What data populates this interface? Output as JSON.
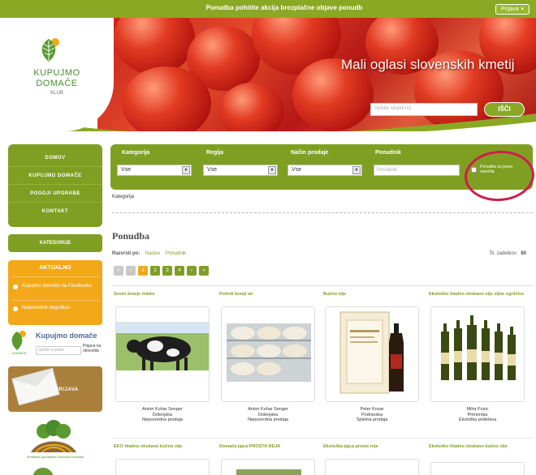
{
  "topbar": {
    "promo_text": "Ponudba pohitite akcija brezplačne objave ponudb",
    "lang_button": "Prijava"
  },
  "header": {
    "logo_line1": "KUPUJMO",
    "logo_line2": "DOMAČE",
    "logo_line3": "KLUB",
    "tagline": "Mali oglasi slovenskih kmetij",
    "search_placeholder": "Vpišite iskalni niz",
    "search_button": "IŠČI"
  },
  "sidebar": {
    "nav_items": [
      "DOMOV",
      "KUPUJMO DOMAČE",
      "POGOJI UPORABE",
      "KONTAKT"
    ],
    "green_button": "KATEGORIJE",
    "orange_box": {
      "title": "AKTUALNO",
      "items": [
        "Kupujmo domače na Facebooku",
        "Napovednik dogodkov"
      ]
    },
    "rapid": {
      "title": "Kupujmo domače",
      "field_placeholder": "vpišite e-pošto",
      "note": "Prijava na obvestila"
    },
    "brown_box_label": "PRIJAVA",
    "sponsor_text": "Kmetijsko gozdarska zbornica Slovenije"
  },
  "filters": {
    "labels": [
      "Kategorija",
      "Regija",
      "Način prodaje",
      "Ponudnik"
    ],
    "selects": [
      "Vse",
      "Vse",
      "Vse"
    ],
    "ponudnik_placeholder": "Ponudnik",
    "checkbox_label": "Ponudba za javna naročila"
  },
  "main": {
    "kategorija_link": "Kategorija",
    "section_title": "Ponudba",
    "sort_label": "Razvrsti po:",
    "sort_links": [
      "Naslov",
      "Ponudnik"
    ],
    "count_label": "Št. zadetkov:",
    "count_value": "80",
    "pages": [
      "«",
      "‹",
      "1",
      "2",
      "3",
      "4",
      "›",
      "»"
    ]
  },
  "cards_row1": [
    {
      "title": "Sveže kravje mleko",
      "desc": [
        "Anton Kuhar Senger",
        "Dolenjska",
        "Neposredna prodaja"
      ]
    },
    {
      "title": "Poltrdi kravji sir",
      "desc": [
        "Anton Kuhar Senger",
        "Dolenjska",
        "Neposredna prodaja"
      ]
    },
    {
      "title": "Bučno olje",
      "desc": [
        "Peter Kosar",
        "Podravska",
        "Spletna prodaja"
      ]
    },
    {
      "title": "Ekološko hladno stiskano olje oljne ogrščice",
      "desc": [
        "Miha Pusic",
        "Primorska",
        "Ekološka pridelava"
      ]
    }
  ],
  "cards_row2": [
    {
      "title": "EKO hladno stiskano bučno olje"
    },
    {
      "title": "Domača jajca PROSTA REJA"
    },
    {
      "title": "Ekološka jajca proste reje"
    },
    {
      "title": "Ekološko hladno stiskano bučno olje"
    }
  ],
  "colors": {
    "brand_green": "#7f9f22",
    "orange": "#f2a818",
    "brown": "#a97f3b",
    "highlight_red": "#d21b4c"
  }
}
